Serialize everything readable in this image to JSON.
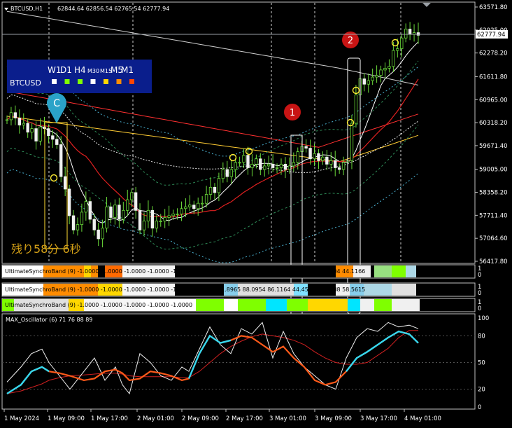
{
  "header": {
    "symbol_tf": "BTCUSD,H1",
    "ohlc": "62844.64 62856.54 62765.54 62777.94"
  },
  "current_price": "62777.94",
  "price_axis": [
    "63571.80",
    "62925.00",
    "62278.20",
    "61611.80",
    "60965.00",
    "60318.20",
    "59671.40",
    "59005.00",
    "58358.20",
    "57711.40",
    "57064.60",
    "56417.80"
  ],
  "time_axis": [
    "1 May 2024",
    "1 May 09:00",
    "1 May 17:00",
    "2 May 01:00",
    "2 May 09:00",
    "2 May 17:00",
    "3 May 01:00",
    "3 May 09:00",
    "3 May 17:00",
    "4 May 01:00"
  ],
  "tf_panel": {
    "tf_labels": [
      "W1",
      "D1",
      "H4",
      "M30",
      "M15",
      "M5",
      "M1"
    ],
    "symbol": "BTCUSD",
    "squares": [
      "#ffffff",
      "#7fff00",
      "#7fff00",
      "#ffffff",
      "#ffd700",
      "#ff8c00",
      "#ff4500"
    ]
  },
  "countdown": "残り58分 6秒",
  "markers": {
    "c": "C",
    "m1": "1",
    "m2": "2"
  },
  "bands": {
    "band1_label": "UltimateSynchroBand (9) -1.0000 -1.0000 -1.0000 -1.0000 -1.0000 -1.0000 58.5419 59.8159 37.9789 46.9213 37.2204 44.1166",
    "band2_label": "UltimateSynchroBand (9) -1.0000 -1.0000 -1.0000 -1.0000 -1.0000 -1.0000 91.8965 88.0954 86.1164 44.4564 92.8488 58.5615",
    "band3_label": "UltimateSynchroBand (9) -1.0000 -1.0000 -1.0000 -1.0000 -1.0000",
    "axis": [
      "1",
      "0"
    ]
  },
  "oscillator": {
    "label": "MAX_Oscillator (6) 71 76 88 89",
    "axis": [
      "100",
      "80",
      "50",
      "20",
      "0"
    ]
  },
  "chart_data": {
    "type": "candlestick",
    "symbol": "BTCUSD",
    "timeframe": "H1",
    "ylim": [
      56300,
      63650
    ],
    "x_ticks": [
      "1 May 2024",
      "1 May 09:00",
      "1 May 17:00",
      "2 May 01:00",
      "2 May 09:00",
      "2 May 17:00",
      "3 May 01:00",
      "3 May 09:00",
      "3 May 17:00",
      "4 May 01:00"
    ],
    "closes": [
      60400,
      60600,
      60450,
      60250,
      60300,
      60050,
      60150,
      59800,
      60200,
      60150,
      59950,
      59850,
      59700,
      58800,
      58450,
      57700,
      57300,
      57450,
      57800,
      58100,
      57600,
      57300,
      57050,
      57350,
      57950,
      57650,
      58000,
      57600,
      57850,
      58150,
      58350,
      57850,
      57300,
      57550,
      57850,
      57350,
      57550,
      57550,
      57650,
      57700,
      57750,
      57750,
      57900,
      57950,
      58000,
      57900,
      58050,
      58050,
      58300,
      58500,
      58350,
      58750,
      59000,
      58800,
      59000,
      59200,
      59200,
      59400,
      59050,
      59150,
      59300,
      59000,
      59100,
      59150,
      59050,
      59050,
      59150,
      59000,
      59100,
      59200,
      59500,
      59650,
      59600,
      59300,
      59450,
      59250,
      59350,
      59150,
      59250,
      59050,
      59000,
      59200,
      59250,
      60300,
      61100,
      61550,
      61400,
      61500,
      61600,
      61650,
      61800,
      61850,
      61900,
      62350,
      62400,
      62700,
      62950,
      62800,
      62850,
      62778
    ],
    "series_overlays": [
      "moving averages",
      "envelope bands"
    ]
  }
}
